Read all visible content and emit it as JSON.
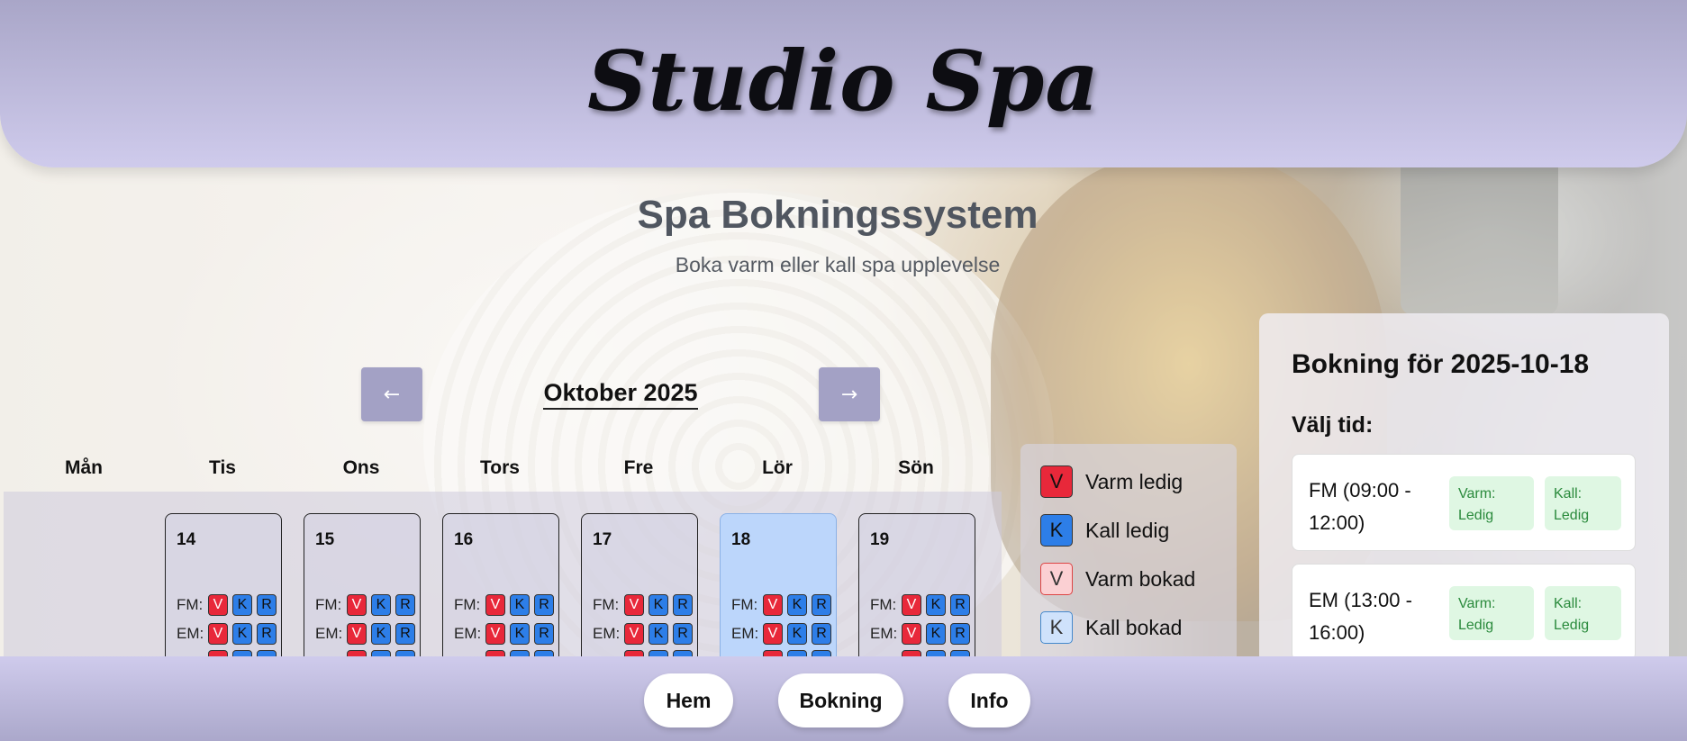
{
  "header": {
    "brand": "Studio Spa"
  },
  "page": {
    "title": "Spa Bokningssystem",
    "subtitle": "Boka varm eller kall spa upplevelse"
  },
  "calendar": {
    "month_label": "Oktober 2025",
    "prev_icon": "←",
    "next_icon": "→",
    "weekdays": [
      "Mån",
      "Tis",
      "Ons",
      "Tors",
      "Fre",
      "Lör",
      "Sön"
    ],
    "days": [
      {
        "num": "14",
        "selected": false
      },
      {
        "num": "15",
        "selected": false
      },
      {
        "num": "16",
        "selected": false
      },
      {
        "num": "17",
        "selected": false
      },
      {
        "num": "18",
        "selected": true
      },
      {
        "num": "19",
        "selected": false
      }
    ],
    "slot_labels": {
      "fm": "FM:",
      "em": "EM:"
    },
    "chip_letters": {
      "v": "V",
      "k": "K",
      "r": "R"
    }
  },
  "legend": {
    "items": [
      {
        "letter": "V",
        "label": "Varm ledig",
        "color": "#e8283a"
      },
      {
        "letter": "K",
        "label": "Kall ledig",
        "color": "#2d7ee8"
      },
      {
        "letter": "V",
        "label": "Varm bokad",
        "color": "#fbd0d3"
      },
      {
        "letter": "K",
        "label": "Kall bokad",
        "color": "#cfe2fb"
      }
    ]
  },
  "booking": {
    "title": "Bokning för 2025-10-18",
    "choose_time": "Välj tid:",
    "slots": [
      {
        "label": "FM (09:00 - 12:00)",
        "warm": "Varm: Ledig",
        "cold": "Kall: Ledig"
      },
      {
        "label": "EM (13:00 - 16:00)",
        "warm": "Varm: Ledig",
        "cold": "Kall: Ledig"
      }
    ]
  },
  "footer": {
    "home": "Hem",
    "booking": "Bokning",
    "info": "Info"
  },
  "colors": {
    "header_bg": "#cfcbec",
    "nav_button": "#a3a1c5",
    "selected_day": "#bcd6fb",
    "available_pill": "#dff7e3"
  }
}
